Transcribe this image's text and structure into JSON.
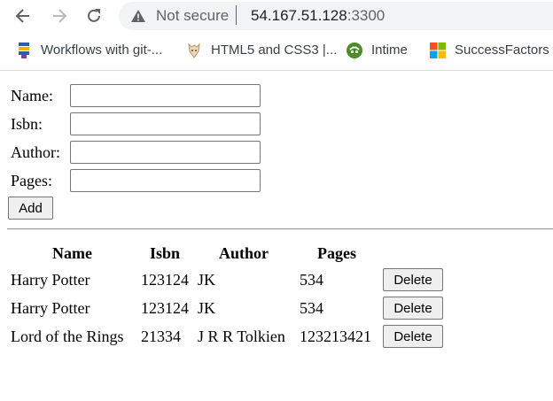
{
  "browser": {
    "security_text": "Not secure",
    "url_host": "54.167.51.128",
    "url_port": ":3300",
    "bookmarks": [
      {
        "label": "Workflows with git-...",
        "icon": "git-workflow-icon"
      },
      {
        "label": "HTML5 and CSS3 |...",
        "icon": "html-css-icon"
      },
      {
        "label": "Intime",
        "icon": "intime-icon"
      },
      {
        "label": "SuccessFactors Le",
        "icon": "successfactors-icon"
      }
    ]
  },
  "form": {
    "fields": [
      {
        "label": "Name:",
        "value": ""
      },
      {
        "label": "Isbn:",
        "value": ""
      },
      {
        "label": "Author:",
        "value": ""
      },
      {
        "label": "Pages:",
        "value": ""
      }
    ],
    "add_label": "Add"
  },
  "table": {
    "headers": [
      "Name",
      "Isbn",
      "Author",
      "Pages"
    ],
    "rows": [
      {
        "name": "Harry Potter",
        "isbn": "123124",
        "author": "JK",
        "pages": "534",
        "delete_label": "Delete"
      },
      {
        "name": "Harry Potter",
        "isbn": "123124",
        "author": "JK",
        "pages": "534",
        "delete_label": "Delete"
      },
      {
        "name": "Lord of the Rings",
        "isbn": "21334",
        "author": "J R R Tolkien",
        "pages": "123213421",
        "delete_label": "Delete"
      }
    ]
  }
}
